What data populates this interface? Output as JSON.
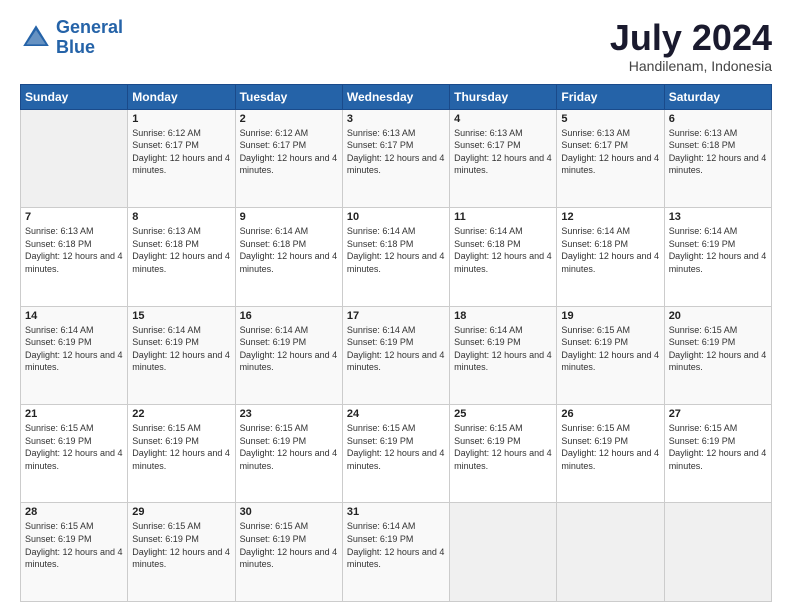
{
  "header": {
    "logo_line1": "General",
    "logo_line2": "Blue",
    "month": "July 2024",
    "location": "Handilenam, Indonesia"
  },
  "weekdays": [
    "Sunday",
    "Monday",
    "Tuesday",
    "Wednesday",
    "Thursday",
    "Friday",
    "Saturday"
  ],
  "weeks": [
    [
      {
        "day": "",
        "empty": true
      },
      {
        "day": "1",
        "sunrise": "6:12 AM",
        "sunset": "6:17 PM",
        "daylight": "12 hours and 4 minutes."
      },
      {
        "day": "2",
        "sunrise": "6:12 AM",
        "sunset": "6:17 PM",
        "daylight": "12 hours and 4 minutes."
      },
      {
        "day": "3",
        "sunrise": "6:13 AM",
        "sunset": "6:17 PM",
        "daylight": "12 hours and 4 minutes."
      },
      {
        "day": "4",
        "sunrise": "6:13 AM",
        "sunset": "6:17 PM",
        "daylight": "12 hours and 4 minutes."
      },
      {
        "day": "5",
        "sunrise": "6:13 AM",
        "sunset": "6:17 PM",
        "daylight": "12 hours and 4 minutes."
      },
      {
        "day": "6",
        "sunrise": "6:13 AM",
        "sunset": "6:18 PM",
        "daylight": "12 hours and 4 minutes."
      }
    ],
    [
      {
        "day": "7",
        "sunrise": "6:13 AM",
        "sunset": "6:18 PM",
        "daylight": "12 hours and 4 minutes."
      },
      {
        "day": "8",
        "sunrise": "6:13 AM",
        "sunset": "6:18 PM",
        "daylight": "12 hours and 4 minutes."
      },
      {
        "day": "9",
        "sunrise": "6:14 AM",
        "sunset": "6:18 PM",
        "daylight": "12 hours and 4 minutes."
      },
      {
        "day": "10",
        "sunrise": "6:14 AM",
        "sunset": "6:18 PM",
        "daylight": "12 hours and 4 minutes."
      },
      {
        "day": "11",
        "sunrise": "6:14 AM",
        "sunset": "6:18 PM",
        "daylight": "12 hours and 4 minutes."
      },
      {
        "day": "12",
        "sunrise": "6:14 AM",
        "sunset": "6:18 PM",
        "daylight": "12 hours and 4 minutes."
      },
      {
        "day": "13",
        "sunrise": "6:14 AM",
        "sunset": "6:19 PM",
        "daylight": "12 hours and 4 minutes."
      }
    ],
    [
      {
        "day": "14",
        "sunrise": "6:14 AM",
        "sunset": "6:19 PM",
        "daylight": "12 hours and 4 minutes."
      },
      {
        "day": "15",
        "sunrise": "6:14 AM",
        "sunset": "6:19 PM",
        "daylight": "12 hours and 4 minutes."
      },
      {
        "day": "16",
        "sunrise": "6:14 AM",
        "sunset": "6:19 PM",
        "daylight": "12 hours and 4 minutes."
      },
      {
        "day": "17",
        "sunrise": "6:14 AM",
        "sunset": "6:19 PM",
        "daylight": "12 hours and 4 minutes."
      },
      {
        "day": "18",
        "sunrise": "6:14 AM",
        "sunset": "6:19 PM",
        "daylight": "12 hours and 4 minutes."
      },
      {
        "day": "19",
        "sunrise": "6:15 AM",
        "sunset": "6:19 PM",
        "daylight": "12 hours and 4 minutes."
      },
      {
        "day": "20",
        "sunrise": "6:15 AM",
        "sunset": "6:19 PM",
        "daylight": "12 hours and 4 minutes."
      }
    ],
    [
      {
        "day": "21",
        "sunrise": "6:15 AM",
        "sunset": "6:19 PM",
        "daylight": "12 hours and 4 minutes."
      },
      {
        "day": "22",
        "sunrise": "6:15 AM",
        "sunset": "6:19 PM",
        "daylight": "12 hours and 4 minutes."
      },
      {
        "day": "23",
        "sunrise": "6:15 AM",
        "sunset": "6:19 PM",
        "daylight": "12 hours and 4 minutes."
      },
      {
        "day": "24",
        "sunrise": "6:15 AM",
        "sunset": "6:19 PM",
        "daylight": "12 hours and 4 minutes."
      },
      {
        "day": "25",
        "sunrise": "6:15 AM",
        "sunset": "6:19 PM",
        "daylight": "12 hours and 4 minutes."
      },
      {
        "day": "26",
        "sunrise": "6:15 AM",
        "sunset": "6:19 PM",
        "daylight": "12 hours and 4 minutes."
      },
      {
        "day": "27",
        "sunrise": "6:15 AM",
        "sunset": "6:19 PM",
        "daylight": "12 hours and 4 minutes."
      }
    ],
    [
      {
        "day": "28",
        "sunrise": "6:15 AM",
        "sunset": "6:19 PM",
        "daylight": "12 hours and 4 minutes."
      },
      {
        "day": "29",
        "sunrise": "6:15 AM",
        "sunset": "6:19 PM",
        "daylight": "12 hours and 4 minutes."
      },
      {
        "day": "30",
        "sunrise": "6:15 AM",
        "sunset": "6:19 PM",
        "daylight": "12 hours and 4 minutes."
      },
      {
        "day": "31",
        "sunrise": "6:14 AM",
        "sunset": "6:19 PM",
        "daylight": "12 hours and 4 minutes."
      },
      {
        "day": "",
        "empty": true
      },
      {
        "day": "",
        "empty": true
      },
      {
        "day": "",
        "empty": true
      }
    ]
  ],
  "labels": {
    "sunrise": "Sunrise:",
    "sunset": "Sunset:",
    "daylight": "Daylight:"
  }
}
